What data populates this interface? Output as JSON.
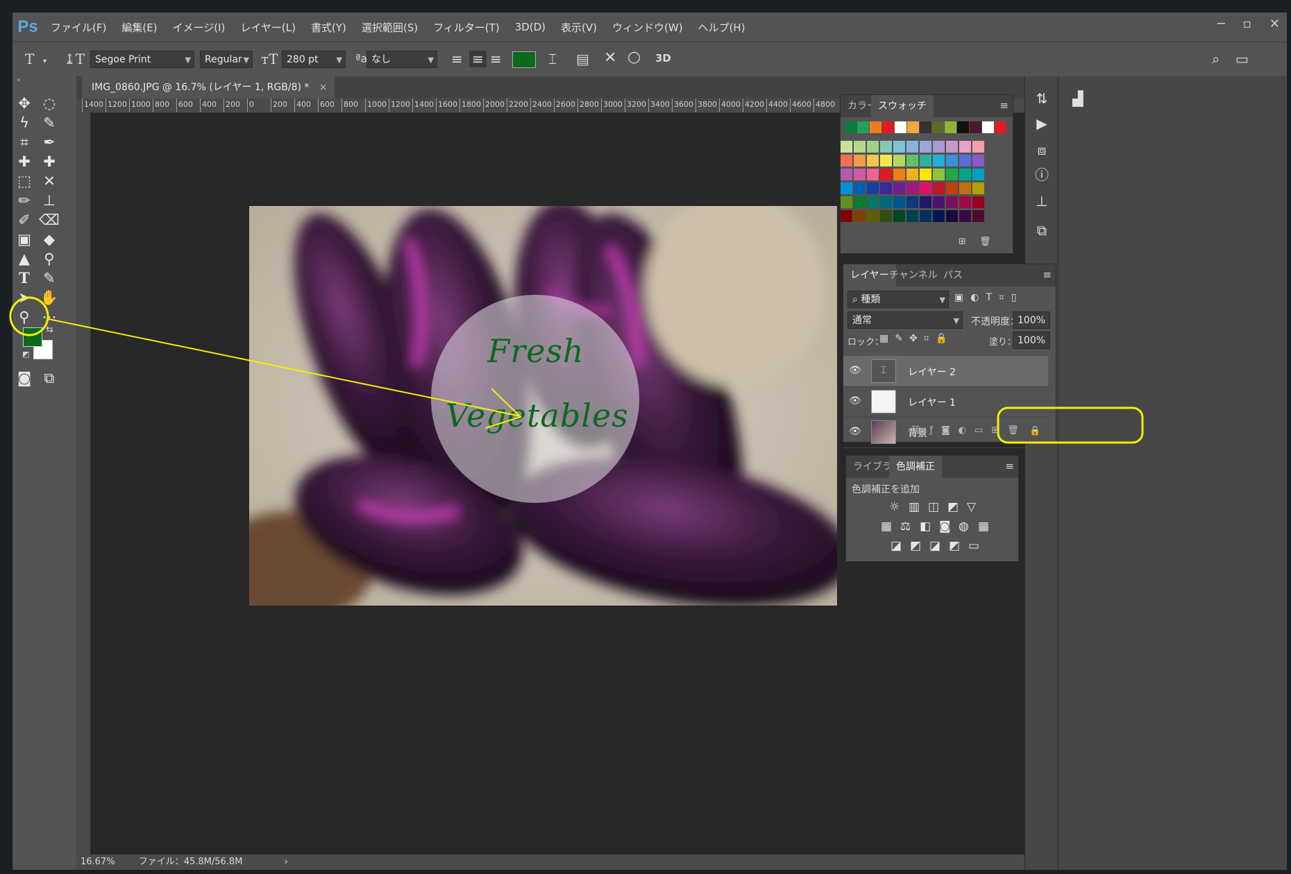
{
  "app": {
    "logo": "Ps"
  },
  "menu": [
    "ファイル(F)",
    "編集(E)",
    "イメージ(I)",
    "レイヤー(L)",
    "書式(Y)",
    "選択範囲(S)",
    "フィルター(T)",
    "3D(D)",
    "表示(V)",
    "ウィンドウ(W)",
    "ヘルプ(H)"
  ],
  "window_controls": {
    "minimize": "─",
    "maximize": "▫",
    "close": "✕"
  },
  "options": {
    "font_family": "Segoe Print",
    "font_style": "Regular",
    "font_size": "280 pt",
    "antialias": "なし",
    "aa_icon_label": "ªa",
    "threed_label": "3D",
    "text_color": "#0b6a1e"
  },
  "document": {
    "tab_title": "IMG_0860.JPG @ 16.7% (レイヤー 1, RGB/8) *",
    "tab_close": "×",
    "ruler_labels": [
      "1400",
      "1200",
      "1000",
      "800",
      "600",
      "400",
      "200",
      "0",
      "200",
      "400",
      "600",
      "800",
      "1000",
      "1200",
      "1400",
      "1600",
      "1800",
      "2000",
      "2200",
      "2400",
      "2600",
      "2800",
      "3000",
      "3200",
      "3400",
      "3600",
      "3800",
      "4000",
      "4200",
      "4400",
      "4600",
      "4800"
    ],
    "overlay_text_line1": "Fresh",
    "overlay_text_line2": "Vegetables"
  },
  "status": {
    "zoom": "16.67%",
    "file_info": "ファイル：45.8M/56.8M",
    "arrow": "›"
  },
  "swatches_panel": {
    "tabs": [
      "カラー",
      "スウォッチ"
    ],
    "active_tab": "スウォッチ",
    "recent": [
      "#0b7a3a",
      "#1fa35a",
      "#f07c1a",
      "#e01b24",
      "#ffffff",
      "#f2a640",
      "#333333",
      "#5b6b2a",
      "#8fb33a",
      "#111111",
      "#4a1a2a",
      "#ffffff",
      "#e01b24"
    ],
    "grid": [
      [
        "#c8e29a",
        "#b6d98a",
        "#9fcf88",
        "#88c9b4",
        "#7cc6d8",
        "#86b3e0",
        "#9aa6d8",
        "#a99ad0",
        "#c49acc",
        "#e4a2c8",
        "#f0a0a6"
      ],
      [
        "#f07050",
        "#f09a50",
        "#f0c850",
        "#f0e850",
        "#b4d860",
        "#60c070",
        "#30b0a0",
        "#20b0d8",
        "#3b8fd8",
        "#5a6ed0",
        "#8a5ac8"
      ],
      [
        "#b05ab0",
        "#d05aa0",
        "#f06090",
        "#e01b24",
        "#f07c1a",
        "#f0b020",
        "#f8e800",
        "#8cc63e",
        "#20a848",
        "#00a88a",
        "#00a0c0"
      ],
      [
        "#0090d8",
        "#0060b0",
        "#1840a0",
        "#402898",
        "#702090",
        "#a01880",
        "#e0106a",
        "#c01830",
        "#c04010",
        "#c07010",
        "#b0a000"
      ],
      [
        "#609020",
        "#107830",
        "#007860",
        "#006878",
        "#005890",
        "#103880",
        "#201868",
        "#4c1470",
        "#781060",
        "#a00848",
        "#980020"
      ],
      [
        "#800000",
        "#804000",
        "#606000",
        "#305010",
        "#004828",
        "#004050",
        "#003060",
        "#001850",
        "#180840",
        "#380840",
        "#500830"
      ]
    ],
    "menu_icon": "≡"
  },
  "layers_panel": {
    "tabs": [
      "レイヤー",
      "チャンネル",
      "パス"
    ],
    "filter_label": "種類",
    "blend_mode": "通常",
    "opacity_label": "不透明度：",
    "opacity_value": "100%",
    "lock_label": "ロック：",
    "fill_label": "塗り：",
    "fill_value": "100%",
    "layers": [
      {
        "name": "レイヤー 2",
        "type": "text",
        "selected": true
      },
      {
        "name": "レイヤー 1",
        "type": "white",
        "selected": false
      },
      {
        "name": "背景",
        "type": "photo",
        "selected": false,
        "locked": true
      }
    ]
  },
  "adjustments_panel": {
    "tabs": [
      "ライブラリ",
      "色調補正"
    ],
    "active_tab": "色調補正",
    "heading": "色調補正を追加",
    "row1": [
      "☼",
      "▥",
      "◫",
      "◩",
      "▽"
    ],
    "row2": [
      "▦",
      "⚖",
      "◧",
      "◙",
      "◍",
      "▦"
    ],
    "row3": [
      "◪",
      "◩",
      "◪",
      "◩",
      "▭"
    ]
  },
  "colors": {
    "foreground": "#0b6a1e",
    "background": "#ffffff",
    "highlight": "#f4f000"
  }
}
